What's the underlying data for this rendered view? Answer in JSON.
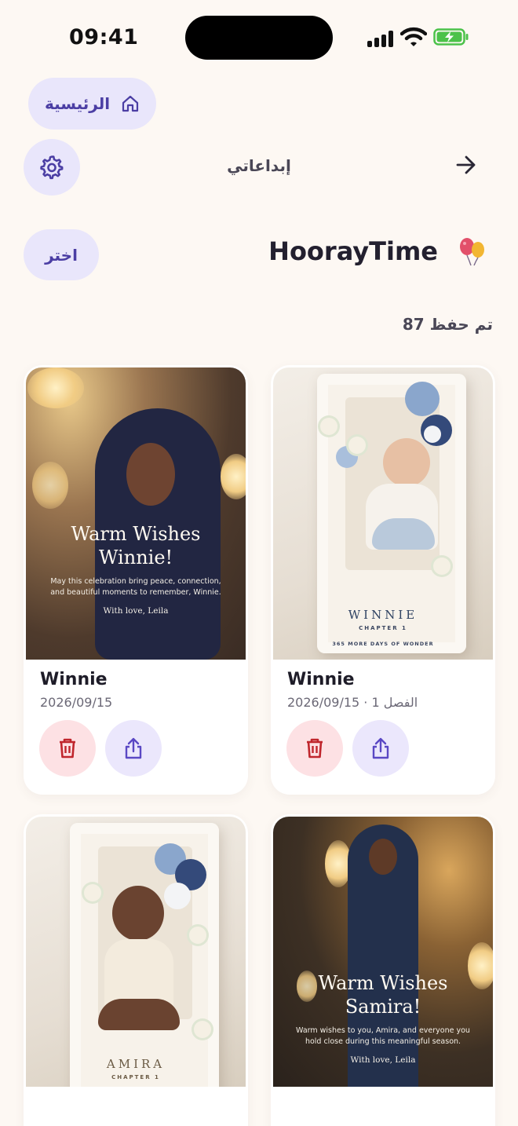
{
  "status_bar": {
    "time": "09:41"
  },
  "header": {
    "home_label": "الرئيسية",
    "title": "إبداعاتي",
    "select_label": "اختر",
    "brand": "HoorayTime",
    "saved_count": "تم حفظ 87"
  },
  "colors": {
    "background": "#fdf8f3",
    "accent": "#4b3ea4",
    "pill_bg": "#e9e6fb",
    "delete_bg": "#fde1e4",
    "delete_icon": "#c0262d"
  },
  "icons": {
    "home": "house-icon",
    "settings": "gear-icon",
    "forward": "arrow-right-icon",
    "brand": "balloons-icon",
    "delete": "trash-icon",
    "share": "share-icon"
  },
  "cards": [
    {
      "name": "Winnie",
      "meta": "2026/09/15",
      "art": {
        "title_line1": "Warm Wishes",
        "title_line2": "Winnie!",
        "message": "May this celebration bring peace, connection, and beautiful moments to remember, Winnie.",
        "signature": "With love, Leila"
      }
    },
    {
      "name": "Winnie",
      "meta": "2026/09/15 · الفصل 1",
      "art": {
        "cover_name": "WINNIE",
        "chapter": "CHAPTER 1",
        "tagline": "365 MORE DAYS OF WONDER"
      }
    },
    {
      "art": {
        "cover_name": "AMIRA",
        "chapter": "CHAPTER 1"
      }
    },
    {
      "art": {
        "title_line1": "Warm Wishes",
        "title_line2": "Samira!",
        "message": "Warm wishes to you, Amira, and everyone you hold close during this meaningful season.",
        "signature": "With love, Leila"
      }
    }
  ]
}
